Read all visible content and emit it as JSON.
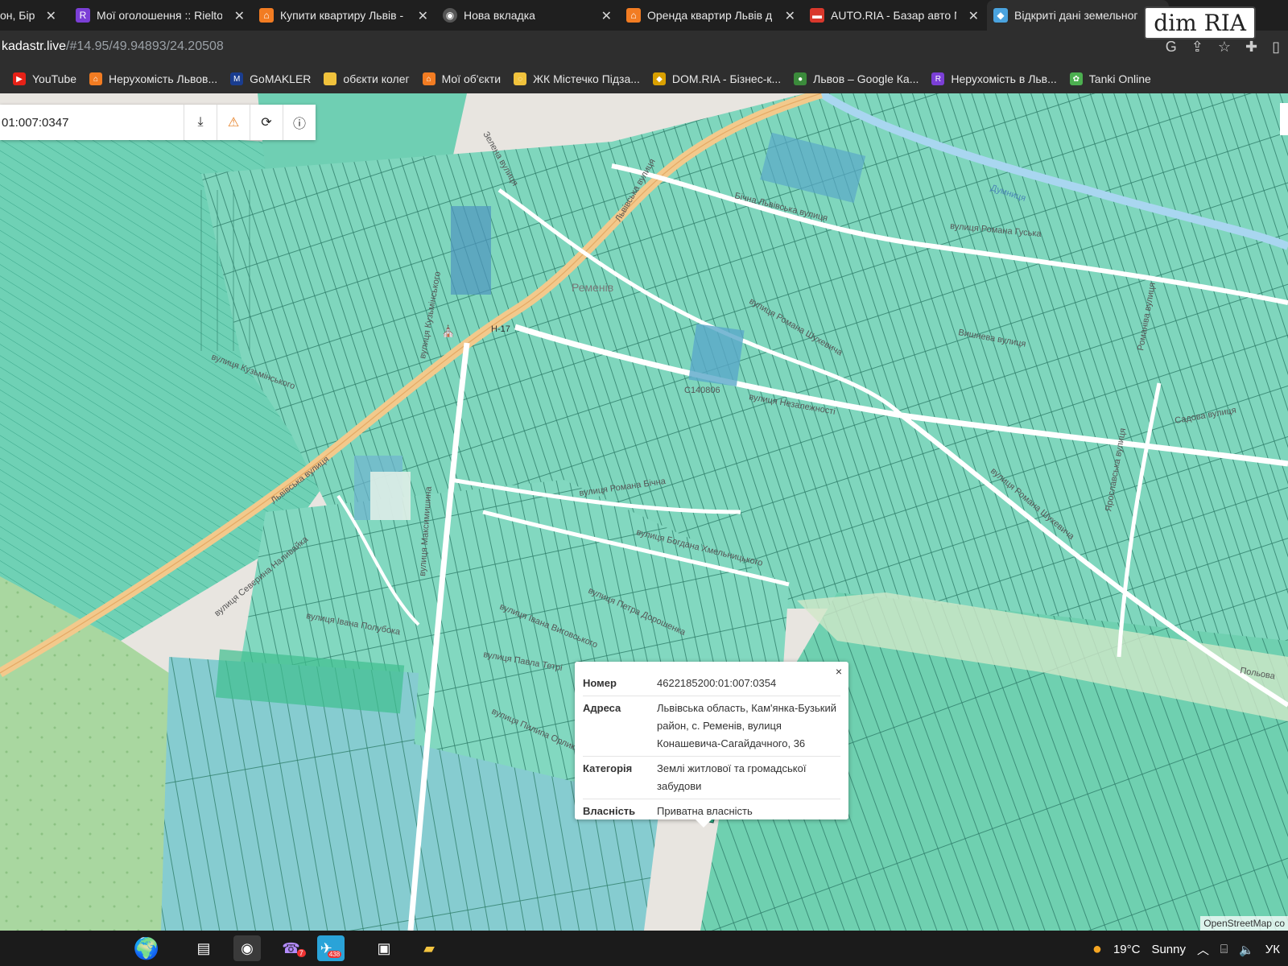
{
  "browser": {
    "tabs": [
      {
        "title": "он, Бірк",
        "icon_color": "#444"
      },
      {
        "title": "Мої оголошення :: Rielto",
        "icon_color": "#7b3fd6"
      },
      {
        "title": "Купити квартиру Львів -",
        "icon_color": "#f27c22"
      },
      {
        "title": "Нова вкладка",
        "icon_color": "#555"
      },
      {
        "title": "Оренда квартир Львів д",
        "icon_color": "#f27c22"
      },
      {
        "title": "AUTO.RIA - Базар авто N",
        "icon_color": "#d9382c"
      },
      {
        "title": "Відкриті дані земельног",
        "icon_color": "#4aa3df"
      }
    ],
    "url_host": "kadastr.live",
    "url_path": "/#14.95/49.94893/24.20508",
    "bookmarks": [
      {
        "label": "YouTube",
        "color": "#e62117"
      },
      {
        "label": "Нерухомість Львов...",
        "color": "#f27c22"
      },
      {
        "label": "GoMAKLER",
        "color": "#1a3d8f"
      },
      {
        "label": "обєкти колег",
        "color": "#f0c23c"
      },
      {
        "label": "Мої об'єкти",
        "color": "#f27c22"
      },
      {
        "label": "ЖК Містечко Підза...",
        "color": "#f0c23c"
      },
      {
        "label": "DOM.RIA - Бізнес-к...",
        "color": "#d9a000"
      },
      {
        "label": "Львов – Google Ка...",
        "color": "#3b8b3b"
      },
      {
        "label": "Нерухомість в Льв...",
        "color": "#7b3fd6"
      },
      {
        "label": "Tanki Online",
        "color": "#4caf50"
      }
    ],
    "watermark": "dim RIA"
  },
  "map": {
    "search_value": "01:007:0347",
    "attribution": "OpenStreetMap co",
    "labels": {
      "village": "Ременів",
      "road_h17": "Н-17",
      "road_c140806": "С140806",
      "lvivska1": "Львівська вулиця",
      "lvivska2": "Львівська вулиця",
      "bichna_lvivska": "Бічна Львівська вулиця",
      "hrushevskoho": "вулиця Романа Гуська",
      "nezalezhnosti": "вулиця Незалежності",
      "shukhevycha": "вулиця Романа Шухевича",
      "shukhevycha2": "вулиця Романа Шухевича",
      "maksymyshyna": "вулиця Максимишина",
      "khmelnytskoho": "вулиця Богдана Хмельницького",
      "doroshenka": "вулиця Петра Дорошенка",
      "kuzmynskoho": "вулиця Кузьмінського",
      "kuzmynskoho2": "вулиця Кузьмінського",
      "bichna": "вулиця Романа Бічна",
      "nalyvaika": "вулиця Северина Наливайка",
      "poluboka": "вулиця Івана Полубока",
      "vyhovskoho": "вулиця Івана Виговського",
      "orlyka": "вулиця Пилипа Орлика",
      "sadova": "Садова вулиця",
      "yablunevа": "Ярославська вулиця",
      "polova": "Польова",
      "dumnytsia": "Думниця",
      "vyshneva": "Вишнева вулиця",
      "rolova": "Романіва вулиця",
      "petra": "вулиця Павла Тетрі",
      "zelena": "Зелена вулиця"
    },
    "popup": {
      "rows": [
        {
          "key": "Номер",
          "value": "4622185200:01:007:0354"
        },
        {
          "key": "Адреса",
          "value": "Львівська область, Кам'янка-Бузький район, с. Ременів, вулиця Конашевича-Сагайдачного, 36"
        },
        {
          "key": "Категорія",
          "value": "Землі житлової та громадської забудови"
        },
        {
          "key": "Власність",
          "value": "Приватна власність"
        }
      ],
      "close": "×"
    }
  },
  "taskbar": {
    "weather_temp": "19°C",
    "weather_text": "Sunny",
    "telegram_badge": "438",
    "viber_badge": "7",
    "lang": "УК"
  }
}
